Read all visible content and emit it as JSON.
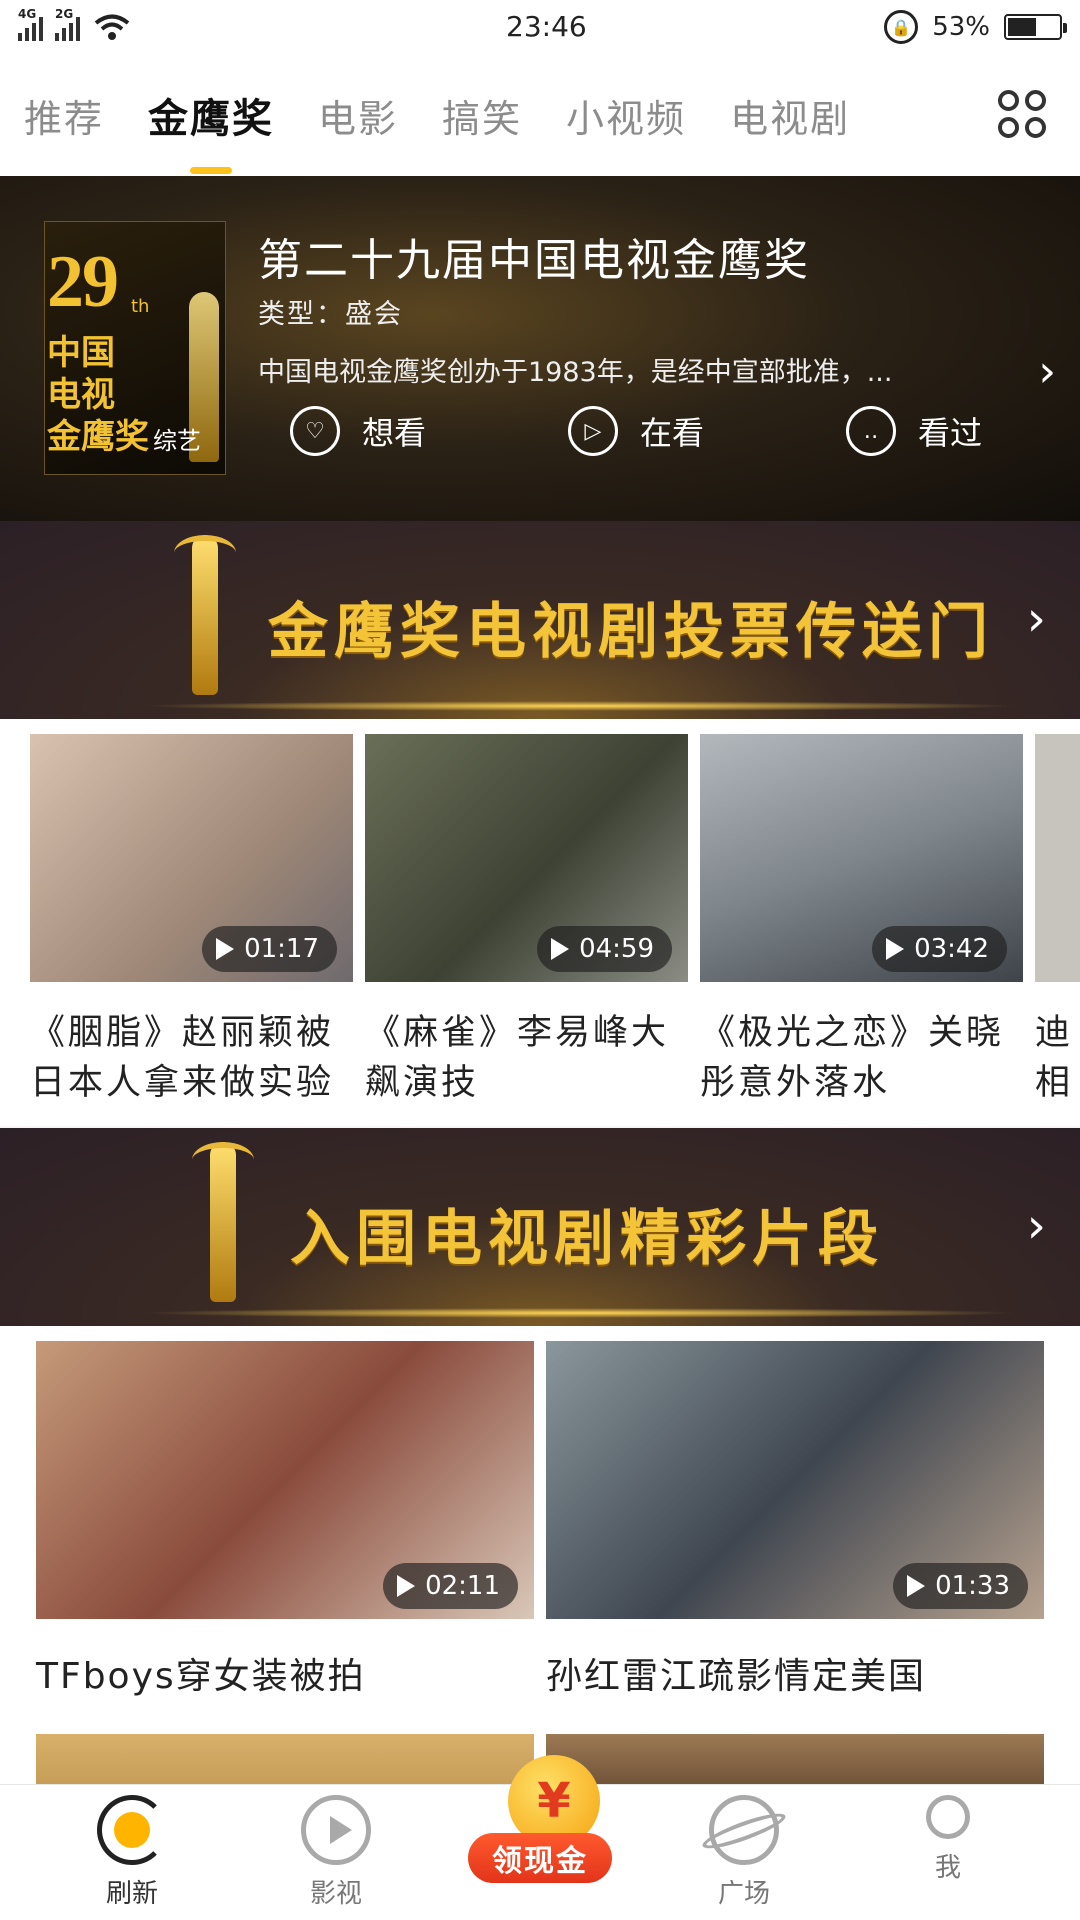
{
  "status_bar": {
    "time": "23:46",
    "battery": "53%",
    "net1": "4G",
    "net2": "2G"
  },
  "tabs": [
    {
      "label": "推荐"
    },
    {
      "label": "金鹰奖"
    },
    {
      "label": "电影"
    },
    {
      "label": "搞笑"
    },
    {
      "label": "小视频"
    },
    {
      "label": "电视剧"
    }
  ],
  "active_tab": "金鹰奖",
  "show": {
    "poster_number": "29",
    "poster_suffix": "th",
    "poster_title": "中国\n电视\n金鹰奖",
    "poster_tag": "综艺",
    "title": "第二十九届中国电视金鹰奖",
    "type": "类型：盛会",
    "description": "中国电视金鹰奖创办于1983年，是经中宣部批准，...",
    "actions": [
      {
        "label": "想看",
        "icon": "heart-smile-icon"
      },
      {
        "label": "在看",
        "icon": "play-circle-icon"
      },
      {
        "label": "看过",
        "icon": "face-icon"
      }
    ]
  },
  "banners": {
    "vote": "金鹰奖电视剧投票传送门",
    "clips": "入围电视剧精彩片段"
  },
  "row_videos": [
    {
      "duration": "01:17",
      "caption": "《胭脂》赵丽颖被日本人拿来做实验",
      "bg": "#b9a08e"
    },
    {
      "duration": "04:59",
      "caption": "《麻雀》李易峰大飙演技",
      "bg": "#4f5542"
    },
    {
      "duration": "03:42",
      "caption": "《极光之恋》关晓彤意外落水",
      "bg": "#8e9499"
    },
    {
      "duration": "",
      "caption": "迪相",
      "bg": "#c7c3bd"
    }
  ],
  "grid_videos": [
    {
      "duration": "02:11",
      "caption": "TFboys穿女装被拍",
      "bg": "#a56a55"
    },
    {
      "duration": "01:33",
      "caption": "孙红雷江疏影情定美国",
      "bg": "#6f7f86"
    }
  ],
  "bottom_nav": [
    {
      "label": "刷新"
    },
    {
      "label": "影视"
    },
    {
      "label": "领现金"
    },
    {
      "label": "广场"
    },
    {
      "label": "我"
    }
  ],
  "colors": {
    "accent": "#ffc21a",
    "gold": "#f3c338",
    "cash": "#e2341a"
  }
}
